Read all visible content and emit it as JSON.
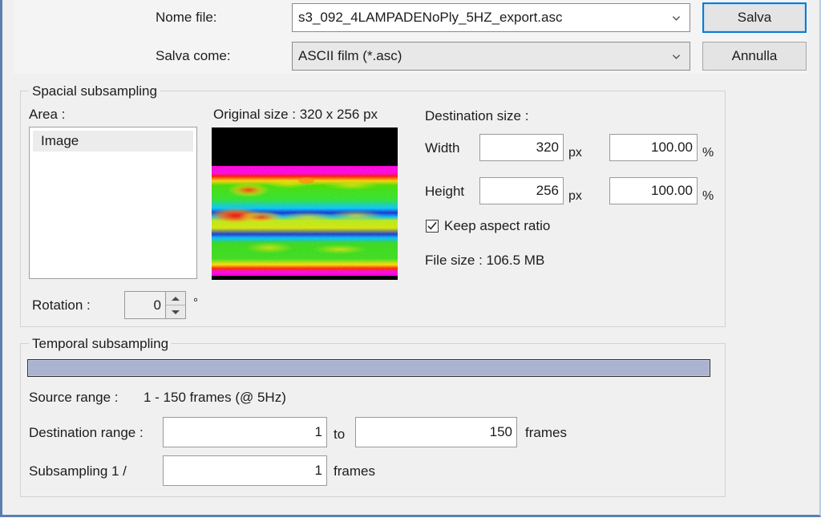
{
  "dialog": {
    "file_name_label": "Nome file:",
    "file_name_value": "s3_092_4LAMPADENoPly_5HZ_export.asc",
    "save_as_label": "Salva come:",
    "save_as_value": "ASCII film (*.asc)",
    "save_button": "Salva",
    "cancel_button": "Annulla",
    "accent_focus_color": "#0a7cd4",
    "window_border_color": "#5b7fb0"
  },
  "spacial": {
    "group_title": "Spacial subsampling",
    "area_label": "Area :",
    "area_items": [
      "Image"
    ],
    "area_selected": "Image",
    "original_size_label": "Original size : 320 x 256 px",
    "destination_size_label": "Destination size :",
    "width_label": "Width",
    "width_px_value": "320",
    "width_px_unit": "px",
    "width_pct_value": "100.00",
    "width_pct_unit": "%",
    "height_label": "Height",
    "height_px_value": "256",
    "height_px_unit": "px",
    "height_pct_value": "100.00",
    "height_pct_unit": "%",
    "keep_aspect_label": "Keep aspect ratio",
    "keep_aspect_checked": true,
    "file_size_label": "File size : 106.5 MB",
    "rotation_label": "Rotation :",
    "rotation_value": "0",
    "rotation_unit": "°"
  },
  "temporal": {
    "group_title": "Temporal subsampling",
    "slider_fill_color": "#aab3d0",
    "source_range_label": "Source range :",
    "source_range_value": "1  -  150  frames    (@ 5Hz)",
    "destination_range_label": "Destination range :",
    "destination_range_from": "1",
    "destination_range_to_label": "to",
    "destination_range_to": "150",
    "destination_range_unit": "frames",
    "subsampling_label": "Subsampling   1 /",
    "subsampling_value": "1",
    "subsampling_unit": "frames"
  }
}
